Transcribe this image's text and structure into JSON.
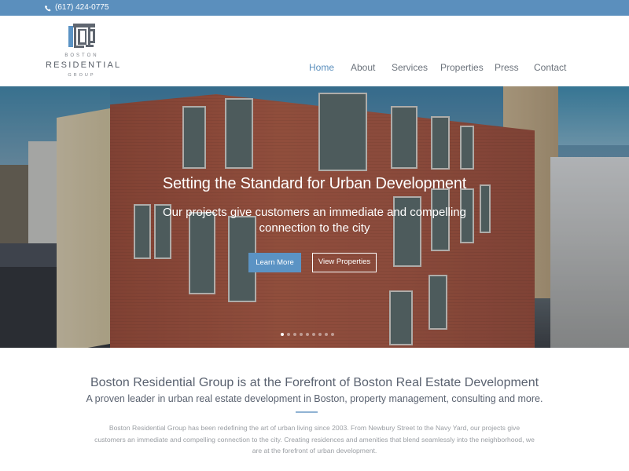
{
  "topbar": {
    "phone_icon": "phone-icon",
    "phone": "(617) 424-0775",
    "background_color": "#5b8fbd"
  },
  "logo": {
    "icon": "building-logo-icon",
    "line1": "BOSTON",
    "line2": "RESIDENTIAL",
    "line3": "GROUP"
  },
  "nav": {
    "active_color": "#5b8fbd",
    "items": [
      {
        "label": "Home",
        "active": true
      },
      {
        "label": "About",
        "active": false
      },
      {
        "label": "Services",
        "active": false
      },
      {
        "label": "Properties",
        "active": false
      },
      {
        "label": "Press",
        "active": false
      },
      {
        "label": "Contact",
        "active": false
      }
    ]
  },
  "hero": {
    "title": "Setting the Standard for Urban Development",
    "subtitle": "Our projects give customers an immediate and compelling connection to the city",
    "primary_button": "Learn More",
    "secondary_button": "View Properties",
    "slide_count": 9,
    "active_slide": 1
  },
  "intro": {
    "heading": "Boston Residential Group is at the Forefront of Boston Real Estate Development",
    "subheading": "A proven leader in urban real estate development in Boston, property management, consulting and more.",
    "body": "Boston Residential Group has been redefining the art of urban living since 2003. From Newbury Street to the Navy Yard, our projects give customers an immediate and compelling connection to the city. Creating residences and amenities that blend seamlessly into the neighborhood, we are at the forefront of urban development."
  }
}
